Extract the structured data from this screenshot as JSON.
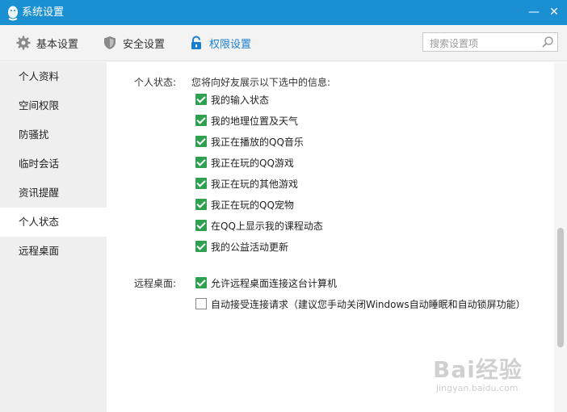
{
  "window": {
    "title": "系统设置",
    "minimize_glyph": "—",
    "close_glyph": "✕"
  },
  "toolbar": {
    "tabs": [
      {
        "label": "基本设置",
        "icon": "gear-icon"
      },
      {
        "label": "安全设置",
        "icon": "shield-icon"
      },
      {
        "label": "权限设置",
        "icon": "lock-icon",
        "active": true
      }
    ],
    "search": {
      "placeholder": "搜索设置项",
      "icon": "search-icon"
    }
  },
  "sidebar": {
    "items": [
      {
        "label": "个人资料"
      },
      {
        "label": "空间权限"
      },
      {
        "label": "防骚扰"
      },
      {
        "label": "临时会话"
      },
      {
        "label": "资讯提醒"
      },
      {
        "label": "个人状态",
        "selected": true
      },
      {
        "label": "远程桌面"
      }
    ]
  },
  "main": {
    "personal_status": {
      "label": "个人状态:",
      "intro": "您将向好友展示以下选中的信息:",
      "options": [
        {
          "label": "我的输入状态",
          "checked": true
        },
        {
          "label": "我的地理位置及天气",
          "checked": true
        },
        {
          "label": "我正在播放的QQ音乐",
          "checked": true
        },
        {
          "label": "我正在玩的QQ游戏",
          "checked": true
        },
        {
          "label": "我正在玩的其他游戏",
          "checked": true
        },
        {
          "label": "我正在玩的QQ宠物",
          "checked": true
        },
        {
          "label": "在QQ上显示我的课程动态",
          "checked": true
        },
        {
          "label": "我的公益活动更新",
          "checked": true
        }
      ]
    },
    "remote_desktop": {
      "label": "远程桌面:",
      "options": [
        {
          "label": "允许远程桌面连接这台计算机",
          "checked": true
        },
        {
          "label": "自动接受连接请求（建议您手动关闭Windows自动睡眠和自动锁屏功能）",
          "checked": false
        }
      ]
    }
  },
  "watermark": {
    "main": "Bai经验",
    "sub": "jingyan.baidu.com"
  },
  "colors": {
    "titlebar": "#1a90d2",
    "active_tab": "#1a7fd0",
    "checkbox_checked": "#2fa04f",
    "sidebar_bg": "#efefef"
  }
}
